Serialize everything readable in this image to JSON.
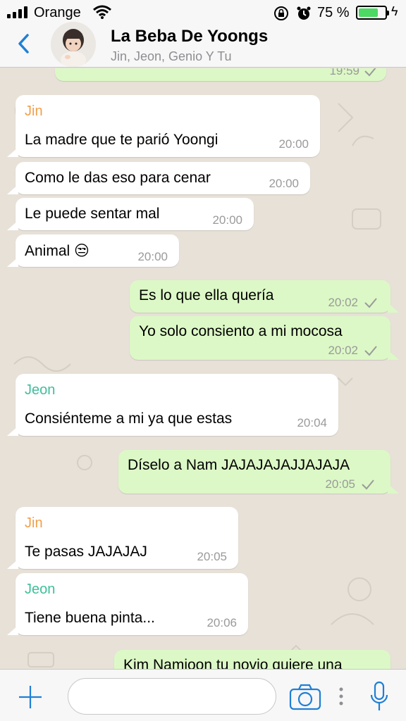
{
  "status_bar": {
    "carrier": "Orange",
    "battery_percent": "75 %",
    "battery_level": 0.75
  },
  "header": {
    "title": "La Beba De Yoongs",
    "subtitle": "Jin, Jeon, Genio Y Tu"
  },
  "colors": {
    "accent": "#1f7fd6",
    "outgoing_bubble": "#dcf8c6",
    "incoming_bubble": "#ffffff",
    "jin_name": "#f0a04b",
    "jeon_name": "#3fbf9a",
    "chat_background": "#e7e1d8"
  },
  "messages": [
    {
      "sender": "Jin",
      "text": "La madre que te parió Yoongi",
      "time": "20:00"
    },
    {
      "text": "Como le das eso para cenar",
      "time": "20:00"
    },
    {
      "text": "Le puede sentar mal",
      "time": "20:00"
    },
    {
      "text": "Animal 😒",
      "time": "20:00"
    },
    {
      "text": "Es lo que ella quería",
      "time": "20:02"
    },
    {
      "text": "Yo solo consiento a mi mocosa",
      "time": "20:02"
    },
    {
      "sender": "Jeon",
      "text": "Consiénteme a mi ya que estas",
      "time": "20:04"
    },
    {
      "text": "Díselo a Nam JAJAJAJAJJAJAJA",
      "time": "20:05"
    },
    {
      "sender": "Jin",
      "text": "Te pasas JAJAJAJ",
      "time": "20:05"
    },
    {
      "sender": "Jeon",
      "text": "Tiene buena pinta...",
      "time": "20:06"
    },
    {
      "text": "Kim Namjoon tu novio quiere una",
      "time": ""
    }
  ],
  "top_partial_time": "19:59",
  "input": {
    "placeholder": ""
  },
  "icons": {
    "back": "chevron-left-icon",
    "plus": "plus-icon",
    "camera": "camera-icon",
    "more": "more-dots-icon",
    "mic": "microphone-icon"
  }
}
